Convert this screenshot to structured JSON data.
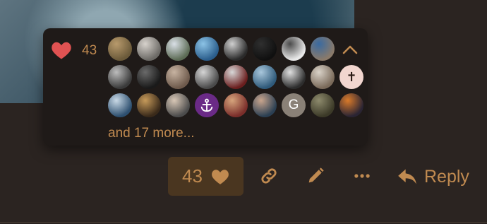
{
  "likes": {
    "count": "43",
    "more_label": "and 17 more...",
    "accent_color": "#c08a50",
    "heart_color": "#e05252",
    "avatars": [
      {
        "kind": "photo",
        "colors": [
          "#6b5a3a",
          "#b89a6c"
        ]
      },
      {
        "kind": "photo",
        "colors": [
          "#6c6a66",
          "#d7d2cc"
        ]
      },
      {
        "kind": "photo",
        "colors": [
          "#5c6b55",
          "#d9dfe6"
        ]
      },
      {
        "kind": "photo",
        "colors": [
          "#2b5e8c",
          "#8cc3e6"
        ]
      },
      {
        "kind": "photo",
        "colors": [
          "#2a2a2a",
          "#cfcfcf"
        ]
      },
      {
        "kind": "photo",
        "colors": [
          "#101010",
          "#2f2f2f"
        ]
      },
      {
        "kind": "photo",
        "colors": [
          "#e9e9e9",
          "#4b4b4b"
        ]
      },
      {
        "kind": "photo",
        "colors": [
          "#8a7a6a",
          "#3a6aa0"
        ]
      },
      {
        "kind": "photo",
        "colors": [
          "#3a3a3a",
          "#bdbdbd"
        ]
      },
      {
        "kind": "photo",
        "colors": [
          "#1a1a1a",
          "#6a6a6a"
        ]
      },
      {
        "kind": "photo",
        "colors": [
          "#6e5a4c",
          "#c7b3a1"
        ]
      },
      {
        "kind": "photo",
        "colors": [
          "#4a4a4a",
          "#d5d5d5"
        ]
      },
      {
        "kind": "photo",
        "colors": [
          "#6a1e1e",
          "#d8d8d8"
        ]
      },
      {
        "kind": "photo",
        "colors": [
          "#2f5a7a",
          "#a9c7dc"
        ]
      },
      {
        "kind": "photo",
        "colors": [
          "#2d2d2d",
          "#e0e0e0"
        ]
      },
      {
        "kind": "photo",
        "colors": [
          "#7a6a5a",
          "#d9d2c8"
        ]
      },
      {
        "kind": "cross",
        "text": "✝"
      },
      {
        "kind": "photo",
        "colors": [
          "#2d4f6f",
          "#c9d9e6"
        ]
      },
      {
        "kind": "photo",
        "colors": [
          "#3a2a1a",
          "#c69a5a"
        ]
      },
      {
        "kind": "photo",
        "colors": [
          "#4b4b4b",
          "#d8c7b6"
        ]
      },
      {
        "kind": "anchor",
        "text": "⚓"
      },
      {
        "kind": "photo",
        "colors": [
          "#7a2e2a",
          "#d6a47c"
        ]
      },
      {
        "kind": "photo",
        "colors": [
          "#2b3f52",
          "#c9a58d"
        ]
      },
      {
        "kind": "letter",
        "text": "G"
      },
      {
        "kind": "photo",
        "colors": [
          "#3c3a28",
          "#8d8a6c"
        ]
      },
      {
        "kind": "photo",
        "colors": [
          "#2a2433",
          "#d97a2a"
        ]
      }
    ]
  },
  "actions": {
    "like_count": "43",
    "reply_label": "Reply"
  }
}
